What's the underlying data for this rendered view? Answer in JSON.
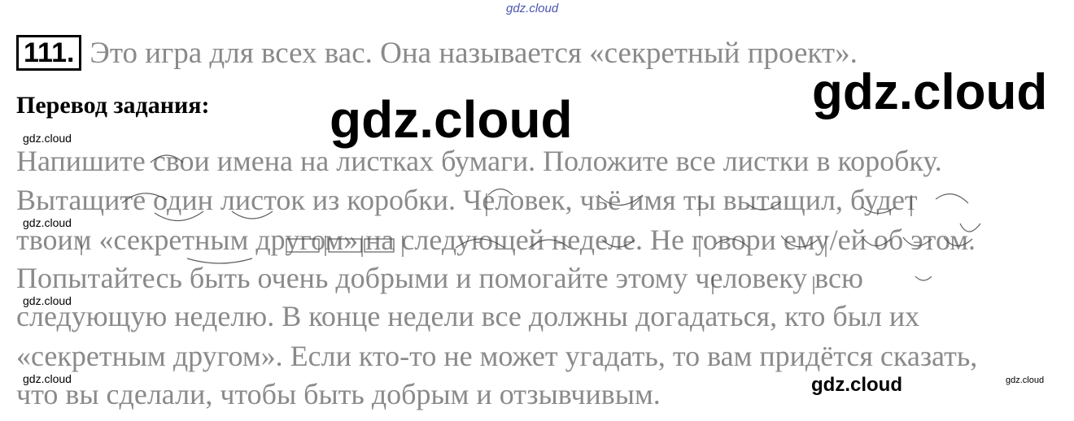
{
  "watermarks": {
    "top": "gdz.cloud",
    "big_right": "gdz.cloud",
    "big_center": "gdz.cloud",
    "small_1": "gdz.cloud",
    "small_2": "gdz.cloud",
    "small_3": "gdz.cloud",
    "small_4": "gdz.cloud",
    "bottom_mid": "gdz.cloud",
    "bottom_tiny": "gdz.cloud"
  },
  "task": {
    "number": "111.",
    "text": "Это игра для всех вас. Она называется «секретный проект»."
  },
  "subheading": "Перевод задания:",
  "body_lines": [
    "Напишите свои имена на листках бумаги. Положите все листки в коробку.",
    "Вытащите один листок из коробки. Человек, чьё имя ты вытащил, будет",
    "твоим «секретным другом» на следующей неделе. Не говори ему/ей об этом.",
    "Попытайтесь быть очень добрыми и помогайте этому человеку всю",
    "следующую неделю. В конце недели все должны догадаться, кто был их",
    "«секретным другом». Если кто-то не может угадать, то вам придётся сказать,",
    "что вы сделали, чтобы быть добрым и отзывчивым."
  ]
}
